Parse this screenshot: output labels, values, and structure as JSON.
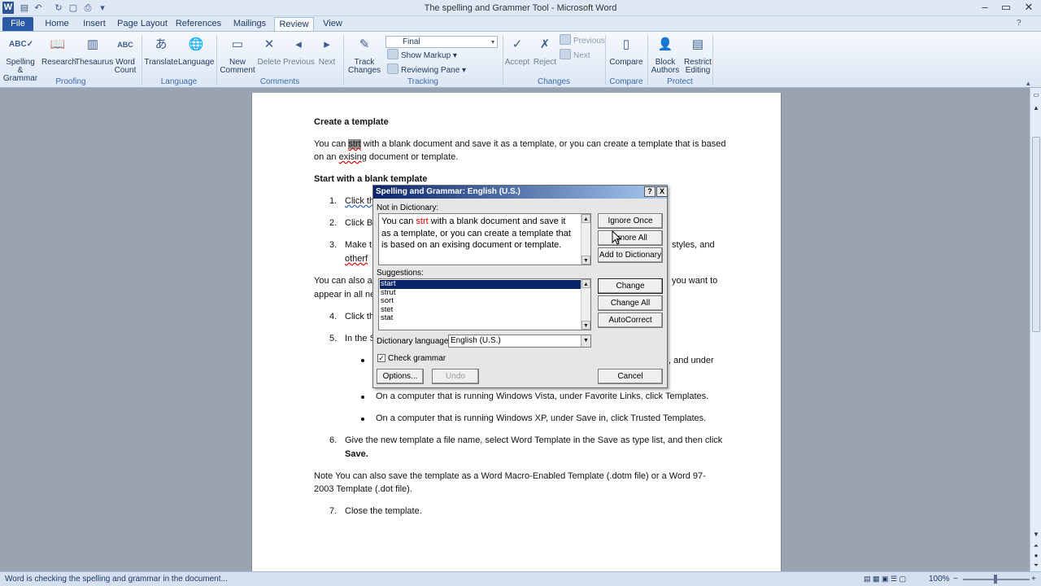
{
  "window": {
    "title": "The spelling and Grammer Tool  -  Microsoft Word",
    "app_icon": "W",
    "qat_icons": [
      "save-icon",
      "undo-icon",
      "redo-icon",
      "print-preview-icon",
      "quick-print-icon",
      "customize-qat-icon"
    ],
    "controls": [
      "minimize",
      "maximize",
      "close"
    ]
  },
  "tabs": [
    {
      "label": "File"
    },
    {
      "label": "Home"
    },
    {
      "label": "Insert"
    },
    {
      "label": "Page Layout"
    },
    {
      "label": "References"
    },
    {
      "label": "Mailings"
    },
    {
      "label": "Review"
    },
    {
      "label": "View"
    }
  ],
  "ribbon": {
    "proofing": {
      "label": "Proofing",
      "spelling": "Spelling &",
      "spelling2": "Grammar",
      "research": "Research",
      "thesaurus": "Thesaurus",
      "wordcount": "Word",
      "wordcount2": "Count"
    },
    "language": {
      "label": "Language",
      "translate": "Translate",
      "language": "Language"
    },
    "comments": {
      "label": "Comments",
      "new": "New",
      "new2": "Comment",
      "delete": "Delete",
      "previous": "Previous",
      "next": "Next"
    },
    "tracking": {
      "label": "Tracking",
      "track": "Track",
      "track2": "Changes",
      "final": "Final",
      "show_markup": "Show Markup",
      "reviewing_pane": "Reviewing Pane"
    },
    "changes": {
      "label": "Changes",
      "accept": "Accept",
      "reject": "Reject",
      "previous": "Previous",
      "next": "Next"
    },
    "compare": {
      "label": "Compare",
      "compare": "Compare"
    },
    "protect": {
      "label": "Protect",
      "block": "Block",
      "block2": "Authors",
      "restrict": "Restrict",
      "restrict2": "Editing"
    }
  },
  "document": {
    "h1": "Create a template",
    "p1_a": "You can ",
    "p1_err": "strt",
    "p1_b": " with a blank document and save it as a template, or you can create a template that is based",
    "p1_c": "on an ",
    "p1_err2": "exising",
    "p1_d": " document or template.",
    "h2": "Start with a blank template",
    "n1": "1.",
    "item1": "Click  th",
    "n2": "2.",
    "item2": "Click Bl",
    "n3": "3.",
    "item3": "Make t",
    "item3_end": "styles, and",
    "item3b": "otherf",
    "p2": "You can also ac",
    "p2_end": "you want to",
    "p2b": "appear in all ne",
    "n4": "4.",
    "item4": "Click th",
    "n5": "5.",
    "item5": "In the S",
    "bullet1_end": ", and under",
    "bullet2": "On a computer that is running Windows Vista, under Favorite Links, click Templates.",
    "bullet3": "On a computer that is running Windows XP, under Save in, click Trusted Templates.",
    "n6": "6.",
    "item6": "Give the new template a file name, select Word Template in the Save as type list, and then click",
    "item6b": "Save.",
    "note": "Note   You can also save the template as a Word Macro-Enabled Template (.dotm file) or a Word 97-",
    "note2": "2003  Template (.dot file).",
    "n7": "7.",
    "item7": "Close the template."
  },
  "dialog": {
    "title": "Spelling and Grammar: English (U.S.)",
    "help": "?",
    "close": "X",
    "not_in_dictionary_label": "Not in Dictionary:",
    "sentence_a": "You can ",
    "sentence_err": "strt",
    "sentence_b": " with a blank document and save it as a template, or you can create a template that is based on an exising document or template.",
    "suggestions_label": "Suggestions:",
    "suggestions": [
      "start",
      "strut",
      "sort",
      "stet",
      "stat"
    ],
    "selected_suggestion": "start",
    "dictionary_language_label": "Dictionary language:",
    "dictionary_language": "English (U.S.)",
    "check_grammar": "Check grammar",
    "check_grammar_checked": true,
    "buttons": {
      "ignore_once": "Ignore Once",
      "ignore_all": "Ignore All",
      "add_to_dictionary": "Add to Dictionary",
      "change": "Change",
      "change_all": "Change All",
      "autocorrect": "AutoCorrect",
      "options": "Options...",
      "undo": "Undo",
      "cancel": "Cancel"
    }
  },
  "status": {
    "message": "Word is checking the spelling and grammar in the document...",
    "zoom": "100%"
  }
}
